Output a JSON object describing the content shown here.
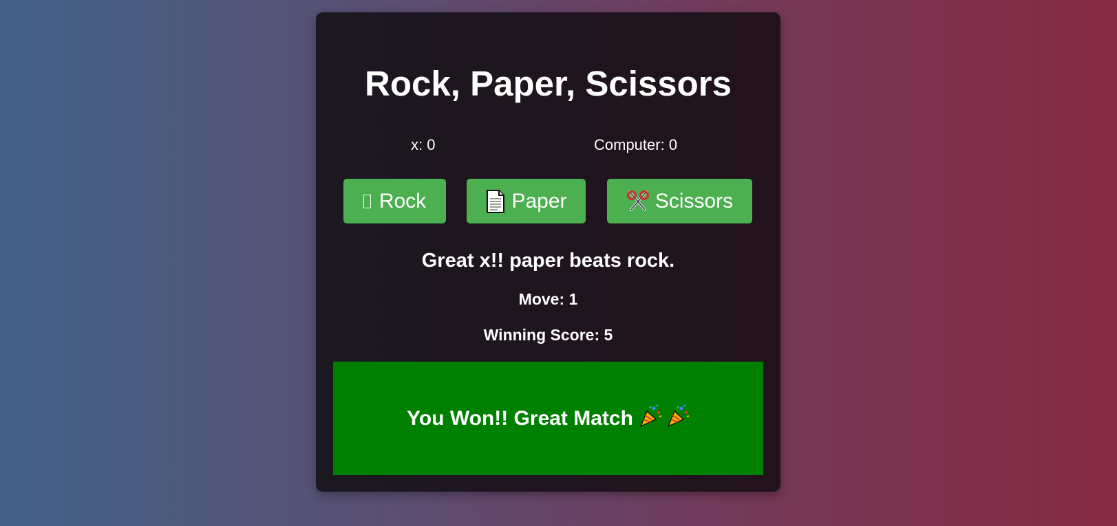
{
  "game": {
    "title": "Rock, Paper, Scissors",
    "player_score": "x: 0",
    "computer_score": "Computer: 0",
    "buttons": {
      "rock": {
        "label": "Rock",
        "icon": "missing-glyph-icon"
      },
      "paper": {
        "label": "Paper",
        "icon": "page-icon"
      },
      "scissors": {
        "label": "Scissors",
        "icon": "scissors-icon"
      }
    },
    "result_message": "Great x!! paper beats rock.",
    "move": "Move: 1",
    "winning_score": "Winning Score: 5",
    "win_banner": {
      "text": "You Won!! Great Match",
      "icons": [
        "party-popper-icon",
        "party-popper-icon"
      ]
    }
  },
  "colors": {
    "button": "#4caf50",
    "banner": "#008000",
    "card": "#1b1820"
  }
}
